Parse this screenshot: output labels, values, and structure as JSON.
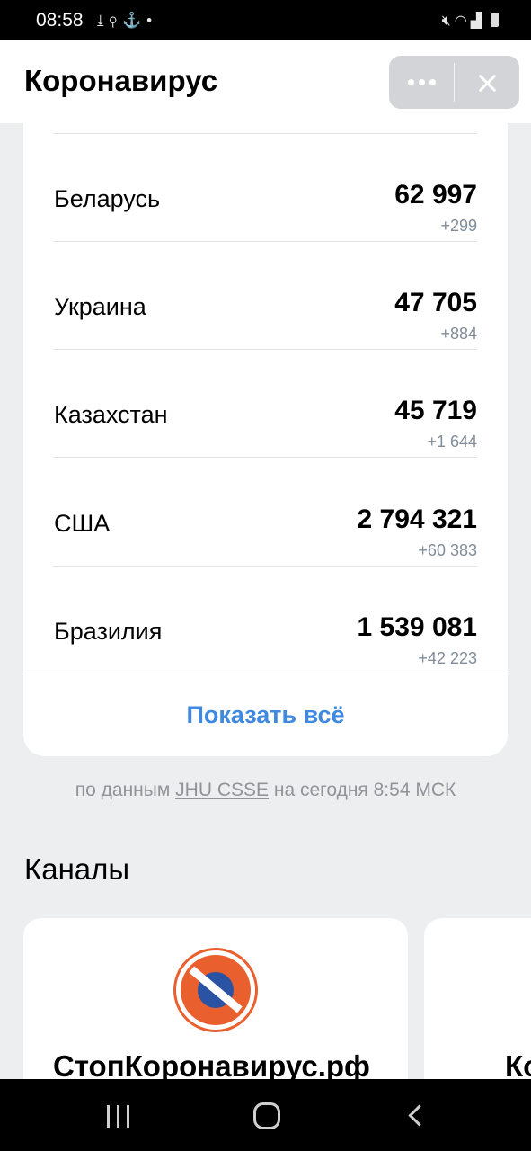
{
  "status_bar": {
    "time": "08:58",
    "left_icons": [
      "download-icon",
      "search-icon",
      "anchor-icon",
      "dot-icon"
    ],
    "right_icons": [
      "mute-icon",
      "wifi-icon",
      "signal-icon",
      "battery-icon"
    ]
  },
  "header": {
    "title": "Коронавирус"
  },
  "stats": {
    "rows": [
      {
        "country": "Беларусь",
        "value": "62 997",
        "delta": "+299"
      },
      {
        "country": "Украина",
        "value": "47 705",
        "delta": "+884"
      },
      {
        "country": "Казахстан",
        "value": "45 719",
        "delta": "+1 644"
      },
      {
        "country": "США",
        "value": "2 794 321",
        "delta": "+60 383"
      },
      {
        "country": "Бразилия",
        "value": "1 539 081",
        "delta": "+42 223"
      }
    ],
    "show_all_label": "Показать всё",
    "accent_color": "#3f8ae0"
  },
  "source": {
    "prefix": "по данным",
    "link": "JHU CSSE",
    "suffix": "на сегодня 8:54 МСК"
  },
  "channels": {
    "title": "Каналы",
    "items": [
      {
        "name": "СтопКоронавирус.рф",
        "logo_icon": "stopcoronavirus-logo-icon"
      },
      {
        "name": "Ко"
      }
    ]
  }
}
